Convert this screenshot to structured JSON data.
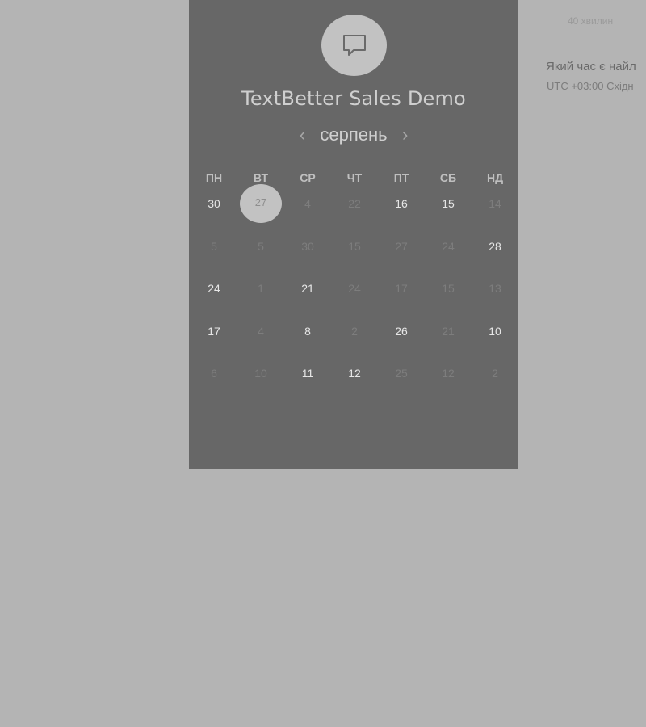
{
  "event": {
    "title": "TextBetter Sales Demo",
    "icon": "chat-bubble-icon"
  },
  "calendar": {
    "month": "серпень",
    "prev_icon": "chevron-left-icon",
    "next_icon": "chevron-right-icon",
    "weekdays": [
      "ПН",
      "ВТ",
      "СР",
      "ЧТ",
      "ПТ",
      "СБ",
      "НД"
    ],
    "weeks": [
      [
        {
          "d": "30",
          "s": "available"
        },
        {
          "d": "27",
          "s": "selected"
        },
        {
          "d": "4",
          "s": "disabled"
        },
        {
          "d": "22",
          "s": "disabled"
        },
        {
          "d": "16",
          "s": "available"
        },
        {
          "d": "15",
          "s": "available"
        },
        {
          "d": "14",
          "s": "disabled"
        }
      ],
      [
        {
          "d": "5",
          "s": "disabled"
        },
        {
          "d": "5",
          "s": "disabled"
        },
        {
          "d": "30",
          "s": "disabled"
        },
        {
          "d": "15",
          "s": "disabled"
        },
        {
          "d": "27",
          "s": "disabled"
        },
        {
          "d": "24",
          "s": "disabled"
        },
        {
          "d": "28",
          "s": "available"
        }
      ],
      [
        {
          "d": "24",
          "s": "available"
        },
        {
          "d": "1",
          "s": "disabled"
        },
        {
          "d": "21",
          "s": "available"
        },
        {
          "d": "24",
          "s": "disabled"
        },
        {
          "d": "17",
          "s": "disabled"
        },
        {
          "d": "15",
          "s": "disabled"
        },
        {
          "d": "13",
          "s": "disabled"
        }
      ],
      [
        {
          "d": "17",
          "s": "available"
        },
        {
          "d": "4",
          "s": "disabled"
        },
        {
          "d": "8",
          "s": "available"
        },
        {
          "d": "2",
          "s": "disabled"
        },
        {
          "d": "26",
          "s": "available"
        },
        {
          "d": "21",
          "s": "disabled"
        },
        {
          "d": "10",
          "s": "available"
        }
      ],
      [
        {
          "d": "6",
          "s": "disabled"
        },
        {
          "d": "10",
          "s": "disabled"
        },
        {
          "d": "11",
          "s": "available"
        },
        {
          "d": "12",
          "s": "available"
        },
        {
          "d": "25",
          "s": "disabled"
        },
        {
          "d": "12",
          "s": "disabled"
        },
        {
          "d": "2",
          "s": "disabled"
        }
      ]
    ]
  },
  "side": {
    "duration": "40 хвилин",
    "question": "Який час є найл",
    "timezone": "UTC +03:00 Східн"
  },
  "colors": {
    "page_background": "#b4b4b4",
    "panel_background": "#676767",
    "accent_circle": "#c2c2c2",
    "available_day": "#e6e6e6",
    "disabled_day": "#7d7d7d"
  }
}
